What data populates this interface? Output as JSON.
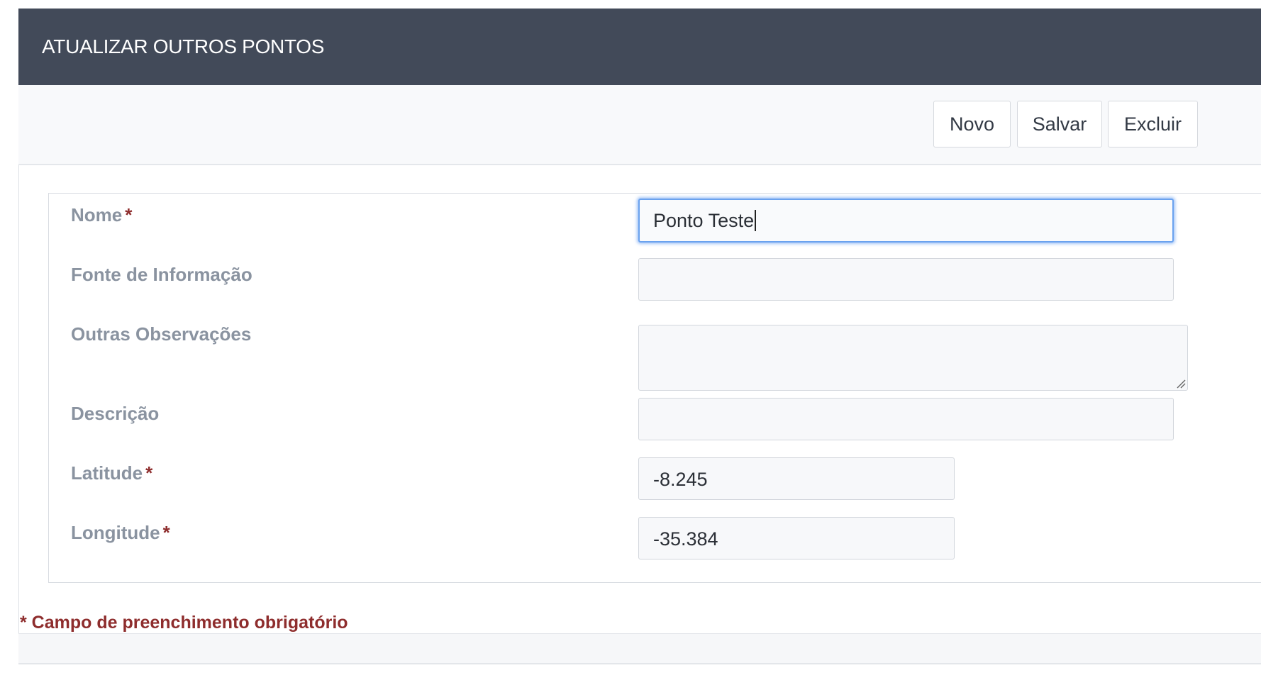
{
  "header": {
    "title": "ATUALIZAR OUTROS PONTOS"
  },
  "toolbar": {
    "new_label": "Novo",
    "save_label": "Salvar",
    "delete_label": "Excluir"
  },
  "form": {
    "nome": {
      "label": "Nome",
      "required_mark": "*",
      "value": "Ponto Teste"
    },
    "fonte": {
      "label": "Fonte de Informação",
      "value": ""
    },
    "observacoes": {
      "label": "Outras Observações",
      "value": ""
    },
    "descricao": {
      "label": "Descrição",
      "value": ""
    },
    "latitude": {
      "label": "Latitude",
      "required_mark": "*",
      "value": "-8.245"
    },
    "longitude": {
      "label": "Longitude",
      "required_mark": "*",
      "value": "-35.384"
    }
  },
  "footer": {
    "required_note": "* Campo de preenchimento obrigatório"
  },
  "colors": {
    "header_bg": "#424a59",
    "required": "#8e2d2d",
    "label": "#8a93a0",
    "focus_ring": "#6aa2ef"
  }
}
